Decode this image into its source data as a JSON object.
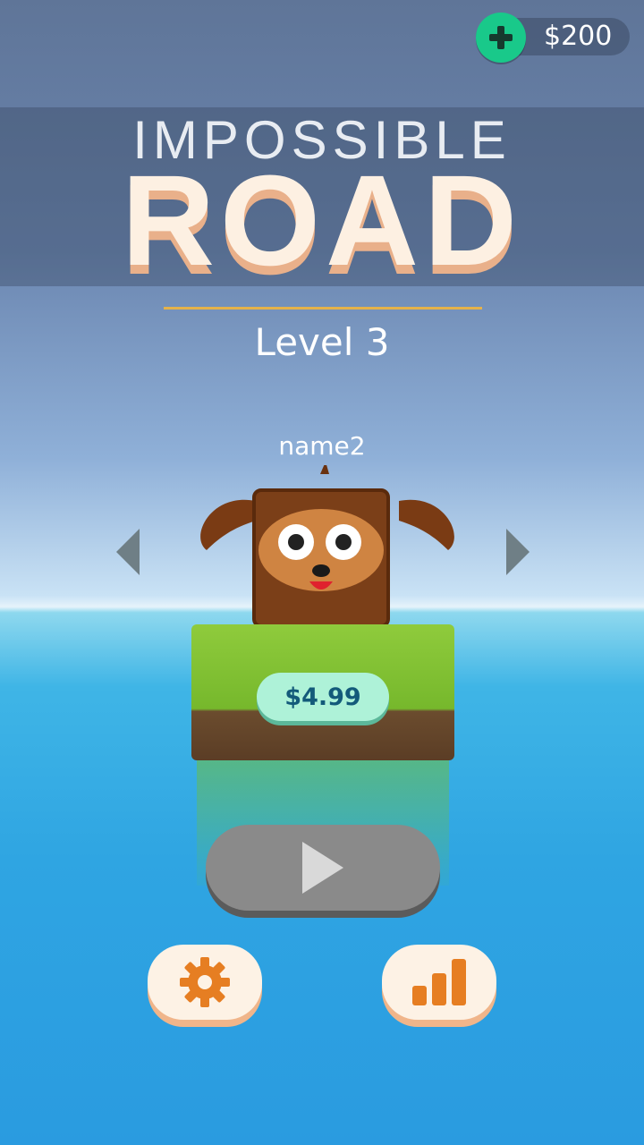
{
  "currency": {
    "amount": "$200",
    "icon": "plus-icon"
  },
  "logo": {
    "line1": "IMPOSSIBLE",
    "line2": "ROAD"
  },
  "level": {
    "label": "Level 3"
  },
  "character": {
    "name": "name2",
    "price": "$4.99"
  },
  "nav": {
    "prev_icon": "chevron-left-icon",
    "next_icon": "chevron-right-icon"
  },
  "buttons": {
    "play_icon": "play-icon",
    "settings_icon": "gear-icon",
    "stats_icon": "bar-chart-icon"
  },
  "colors": {
    "accent_green": "#19c98a",
    "price_bg": "#aef2d8",
    "button_cream": "#fdf2e5",
    "icon_orange": "#e67e22",
    "divider": "#e5b24a"
  }
}
